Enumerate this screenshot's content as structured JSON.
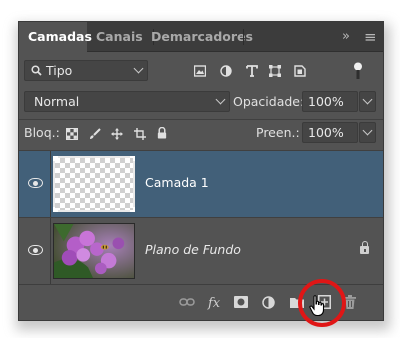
{
  "tabs": [
    "Camadas",
    "Canais",
    "Demarcadores"
  ],
  "tab_controls": {
    "collapse": "»",
    "menu": "≡"
  },
  "filter": {
    "label": "Tipo",
    "icons": [
      "image-filter-icon",
      "adjustment-filter-icon",
      "type-filter-icon",
      "shape-filter-icon",
      "smart-object-filter-icon",
      "filter-toggle-icon"
    ]
  },
  "blend": {
    "mode": "Normal",
    "opacity_label": "Opacidade:",
    "opacity_value": "100%"
  },
  "lock": {
    "label": "Bloq.:",
    "icons": [
      "lock-transparent-icon",
      "lock-paint-icon",
      "lock-move-icon",
      "lock-artboard-icon",
      "lock-all-icon"
    ],
    "fill_label": "Preen.:",
    "fill_value": "100%"
  },
  "layers": [
    {
      "name": "Camada 1",
      "selected": true,
      "visible": true,
      "locked": false
    },
    {
      "name": "Plano de Fundo",
      "selected": false,
      "visible": true,
      "locked": true
    }
  ],
  "bottom_icons": [
    "link-layers-icon",
    "fx-icon",
    "mask-icon",
    "adjustment-icon",
    "group-folder-icon",
    "new-layer-icon",
    "trash-icon"
  ],
  "bottom_fx_label": "fx",
  "colors": {
    "panel": "#535353",
    "selected": "#426079",
    "highlight": "#e01616"
  }
}
